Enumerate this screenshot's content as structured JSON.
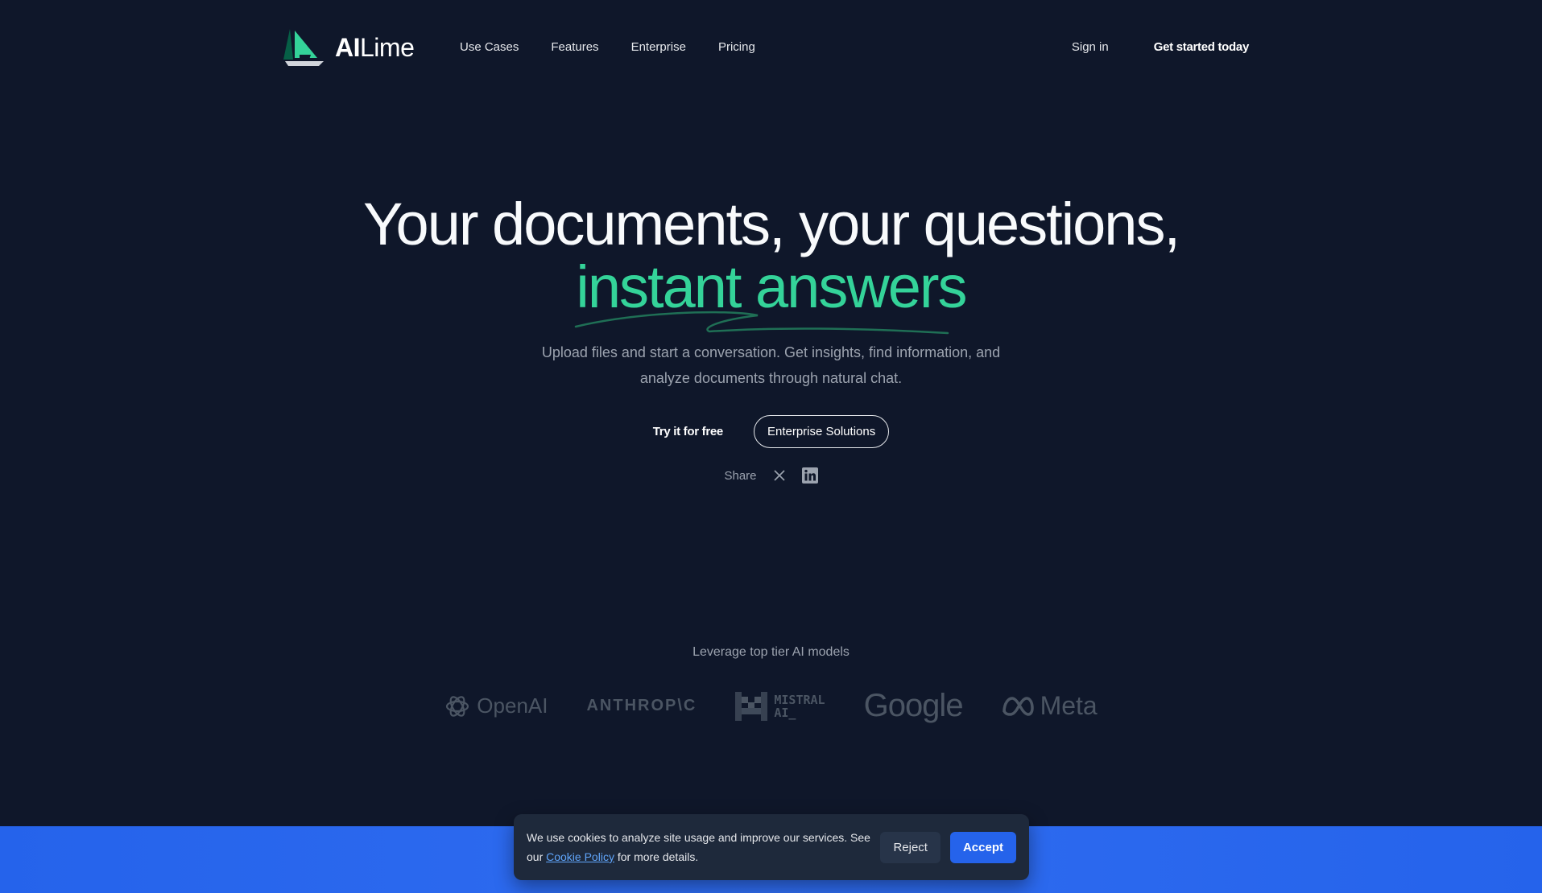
{
  "brand": {
    "name_bold": "AI",
    "name_light": "Lime"
  },
  "nav": {
    "items": [
      {
        "label": "Use Cases"
      },
      {
        "label": "Features"
      },
      {
        "label": "Enterprise"
      },
      {
        "label": "Pricing"
      }
    ],
    "sign_in": "Sign in",
    "get_started": "Get started today"
  },
  "hero": {
    "title_line1": "Your documents, your questions,",
    "title_accent": "instant answers",
    "subtitle": "Upload files and start a conversation. Get insights, find information, and analyze documents through natural chat.",
    "try_free": "Try it for free",
    "enterprise": "Enterprise Solutions",
    "share_label": "Share"
  },
  "models": {
    "title": "Leverage top tier AI models",
    "logos": [
      {
        "name": "OpenAI"
      },
      {
        "name": "ANTHROP\\C"
      },
      {
        "name_line1": "MISTRAL",
        "name_line2": "AI_"
      },
      {
        "name": "Google"
      },
      {
        "name": "Meta"
      }
    ]
  },
  "cookie": {
    "text_before": "We use cookies to analyze site usage and improve our services. See our",
    "link": "Cookie Policy",
    "text_after": "for more details.",
    "reject": "Reject",
    "accept": "Accept"
  },
  "colors": {
    "background": "#0f172a",
    "accent": "#34d399",
    "band": "#2563eb",
    "accept_button": "#2563eb"
  },
  "icons": [
    "sail-logo-icon",
    "x-logo-icon",
    "linkedin-icon",
    "openai-icon",
    "meta-icon"
  ]
}
